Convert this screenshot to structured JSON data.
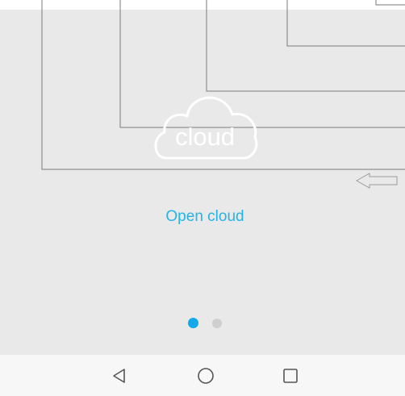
{
  "logo": {
    "text": "cloud",
    "icon": "cloud-icon"
  },
  "actions": {
    "open_label": "Open cloud"
  },
  "pager": {
    "count": 2,
    "active_index": 0
  },
  "navigation": {
    "back_icon": "back-triangle-icon",
    "home_icon": "home-circle-icon",
    "recents_icon": "recents-square-icon"
  },
  "colors": {
    "background": "#e9e9e9",
    "accent": "#26b3e6",
    "dot_active": "#12a9ea",
    "dot_inactive": "#cfcfcf"
  }
}
